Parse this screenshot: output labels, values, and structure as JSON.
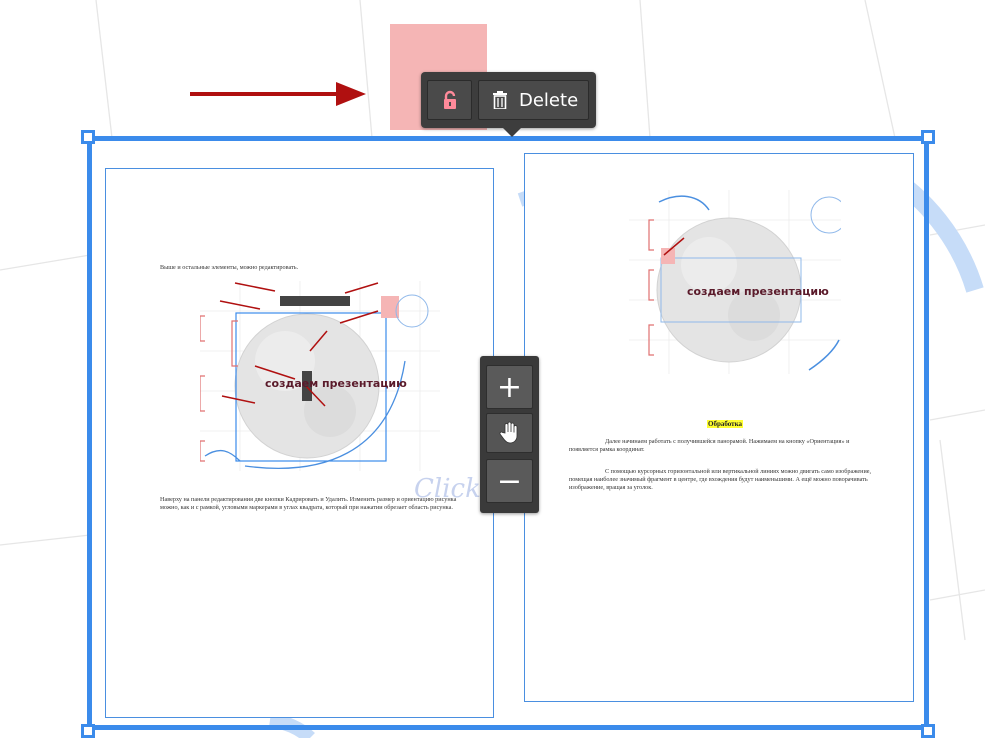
{
  "toolbar": {
    "lock_icon": "lock-icon",
    "delete_icon": "trash-icon",
    "delete_label": "Delete"
  },
  "zoom": {
    "zoom_in": "+",
    "pan_icon": "hand-icon",
    "zoom_out": "−"
  },
  "left_page": {
    "intro": "Выше и остальные элементы, можно редактировать.",
    "circle_caption": "создаем презентацию",
    "paragraph": "Наверху на панели редактирования две кнопки Кадрировать и Удалить. Изменить размер и ориентацию рисунка можно, как и с рамкой, угловыми маркерами в углах квадрата, который при нажатии обрезает область рисунка.",
    "watermark": "Click"
  },
  "right_page": {
    "circle_caption": "создаем презентацию",
    "heading": "Обработка",
    "paragraph1": "Далее начинаем работать с получившейся панорамой. Нажимаем на кнопку «Ориентация» и появляется рамка координат.",
    "paragraph2": "С помощью курсорных горизонтальной или вертикальной линиях можно двигать само изображение, помещая наиболее значимый фрагмент в центре, где вхождения будут наименьшими. А ещё можно поворачивать изображение, вращая за уголок."
  },
  "colors": {
    "selection": "#3b8beb",
    "toolbar_bg": "#3d3d3d",
    "arrow": "#b01010",
    "highlight": "#f5b5b5"
  }
}
